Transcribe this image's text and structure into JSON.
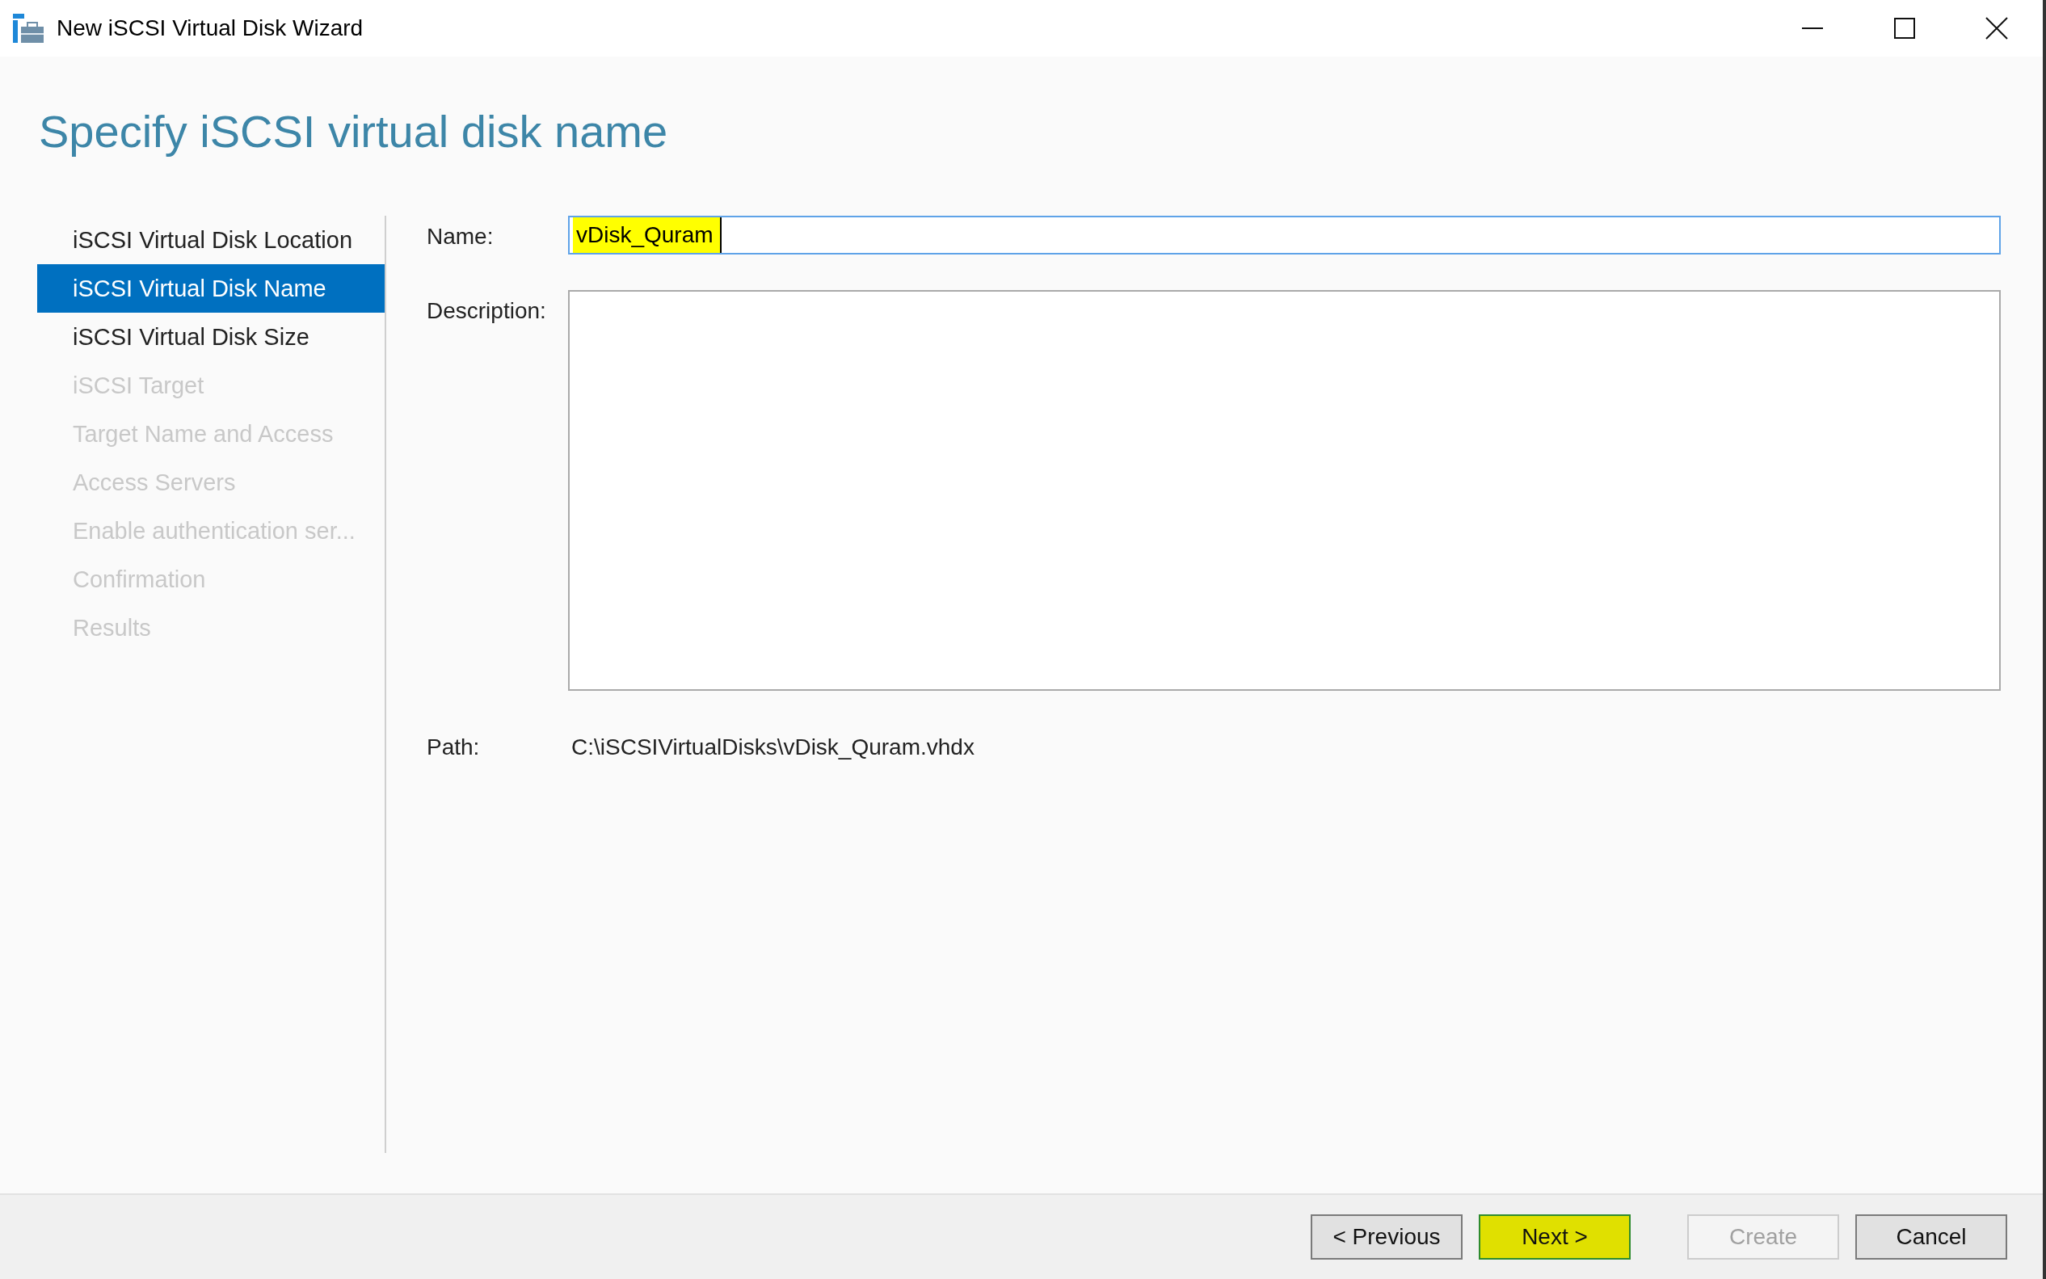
{
  "window": {
    "title": "New iSCSI Virtual Disk Wizard"
  },
  "heading": "Specify iSCSI virtual disk name",
  "steps": [
    {
      "label": "iSCSI Virtual Disk Location",
      "selected": false,
      "disabled": false
    },
    {
      "label": "iSCSI Virtual Disk Name",
      "selected": true,
      "disabled": false
    },
    {
      "label": "iSCSI Virtual Disk Size",
      "selected": false,
      "disabled": false
    },
    {
      "label": "iSCSI Target",
      "selected": false,
      "disabled": true
    },
    {
      "label": "Target Name and Access",
      "selected": false,
      "disabled": true
    },
    {
      "label": "Access Servers",
      "selected": false,
      "disabled": true
    },
    {
      "label": "Enable authentication ser...",
      "selected": false,
      "disabled": true
    },
    {
      "label": "Confirmation",
      "selected": false,
      "disabled": true
    },
    {
      "label": "Results",
      "selected": false,
      "disabled": true
    }
  ],
  "form": {
    "name_label": "Name:",
    "name_value": "vDisk_Quram",
    "name_highlighted": true,
    "description_label": "Description:",
    "path_label": "Path:",
    "path_value": "C:\\iSCSIVirtualDisks\\vDisk_Quram.vhdx"
  },
  "buttons": [
    {
      "label": "< Previous",
      "disabled": false,
      "highlighted": false
    },
    {
      "label": "Next >",
      "disabled": false,
      "highlighted": true
    },
    {
      "label": "Create",
      "disabled": true,
      "highlighted": false
    },
    {
      "label": "Cancel",
      "disabled": false,
      "highlighted": false
    }
  ]
}
